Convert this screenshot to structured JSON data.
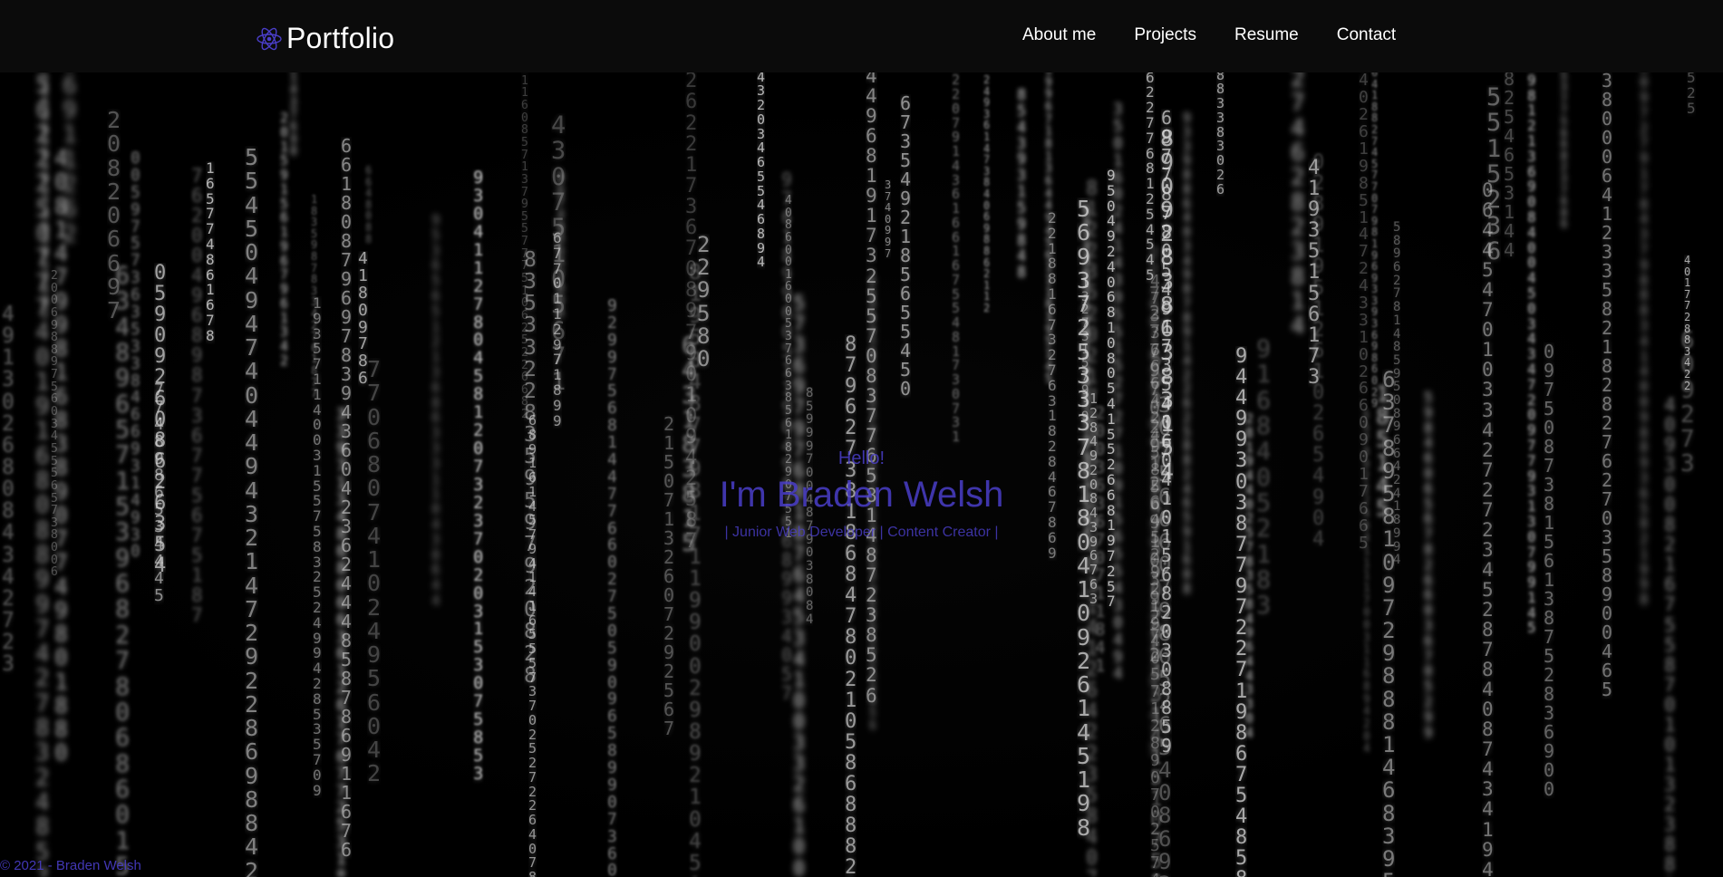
{
  "nav": {
    "brand": "Portfolio",
    "brand_icon": "atom-icon",
    "links": [
      "About me",
      "Projects",
      "Resume",
      "Contact"
    ]
  },
  "hero": {
    "greeting": "Hello!",
    "name": "I'm Braden Welsh",
    "tagline": "| Junior Web Developer | Content Creator |"
  },
  "footer": {
    "copyright": "© 2021 - Braden Welsh"
  },
  "colors": {
    "accent": "#4a3ec9",
    "navbar_bg": "#0b0b0b",
    "background": "#000000"
  }
}
